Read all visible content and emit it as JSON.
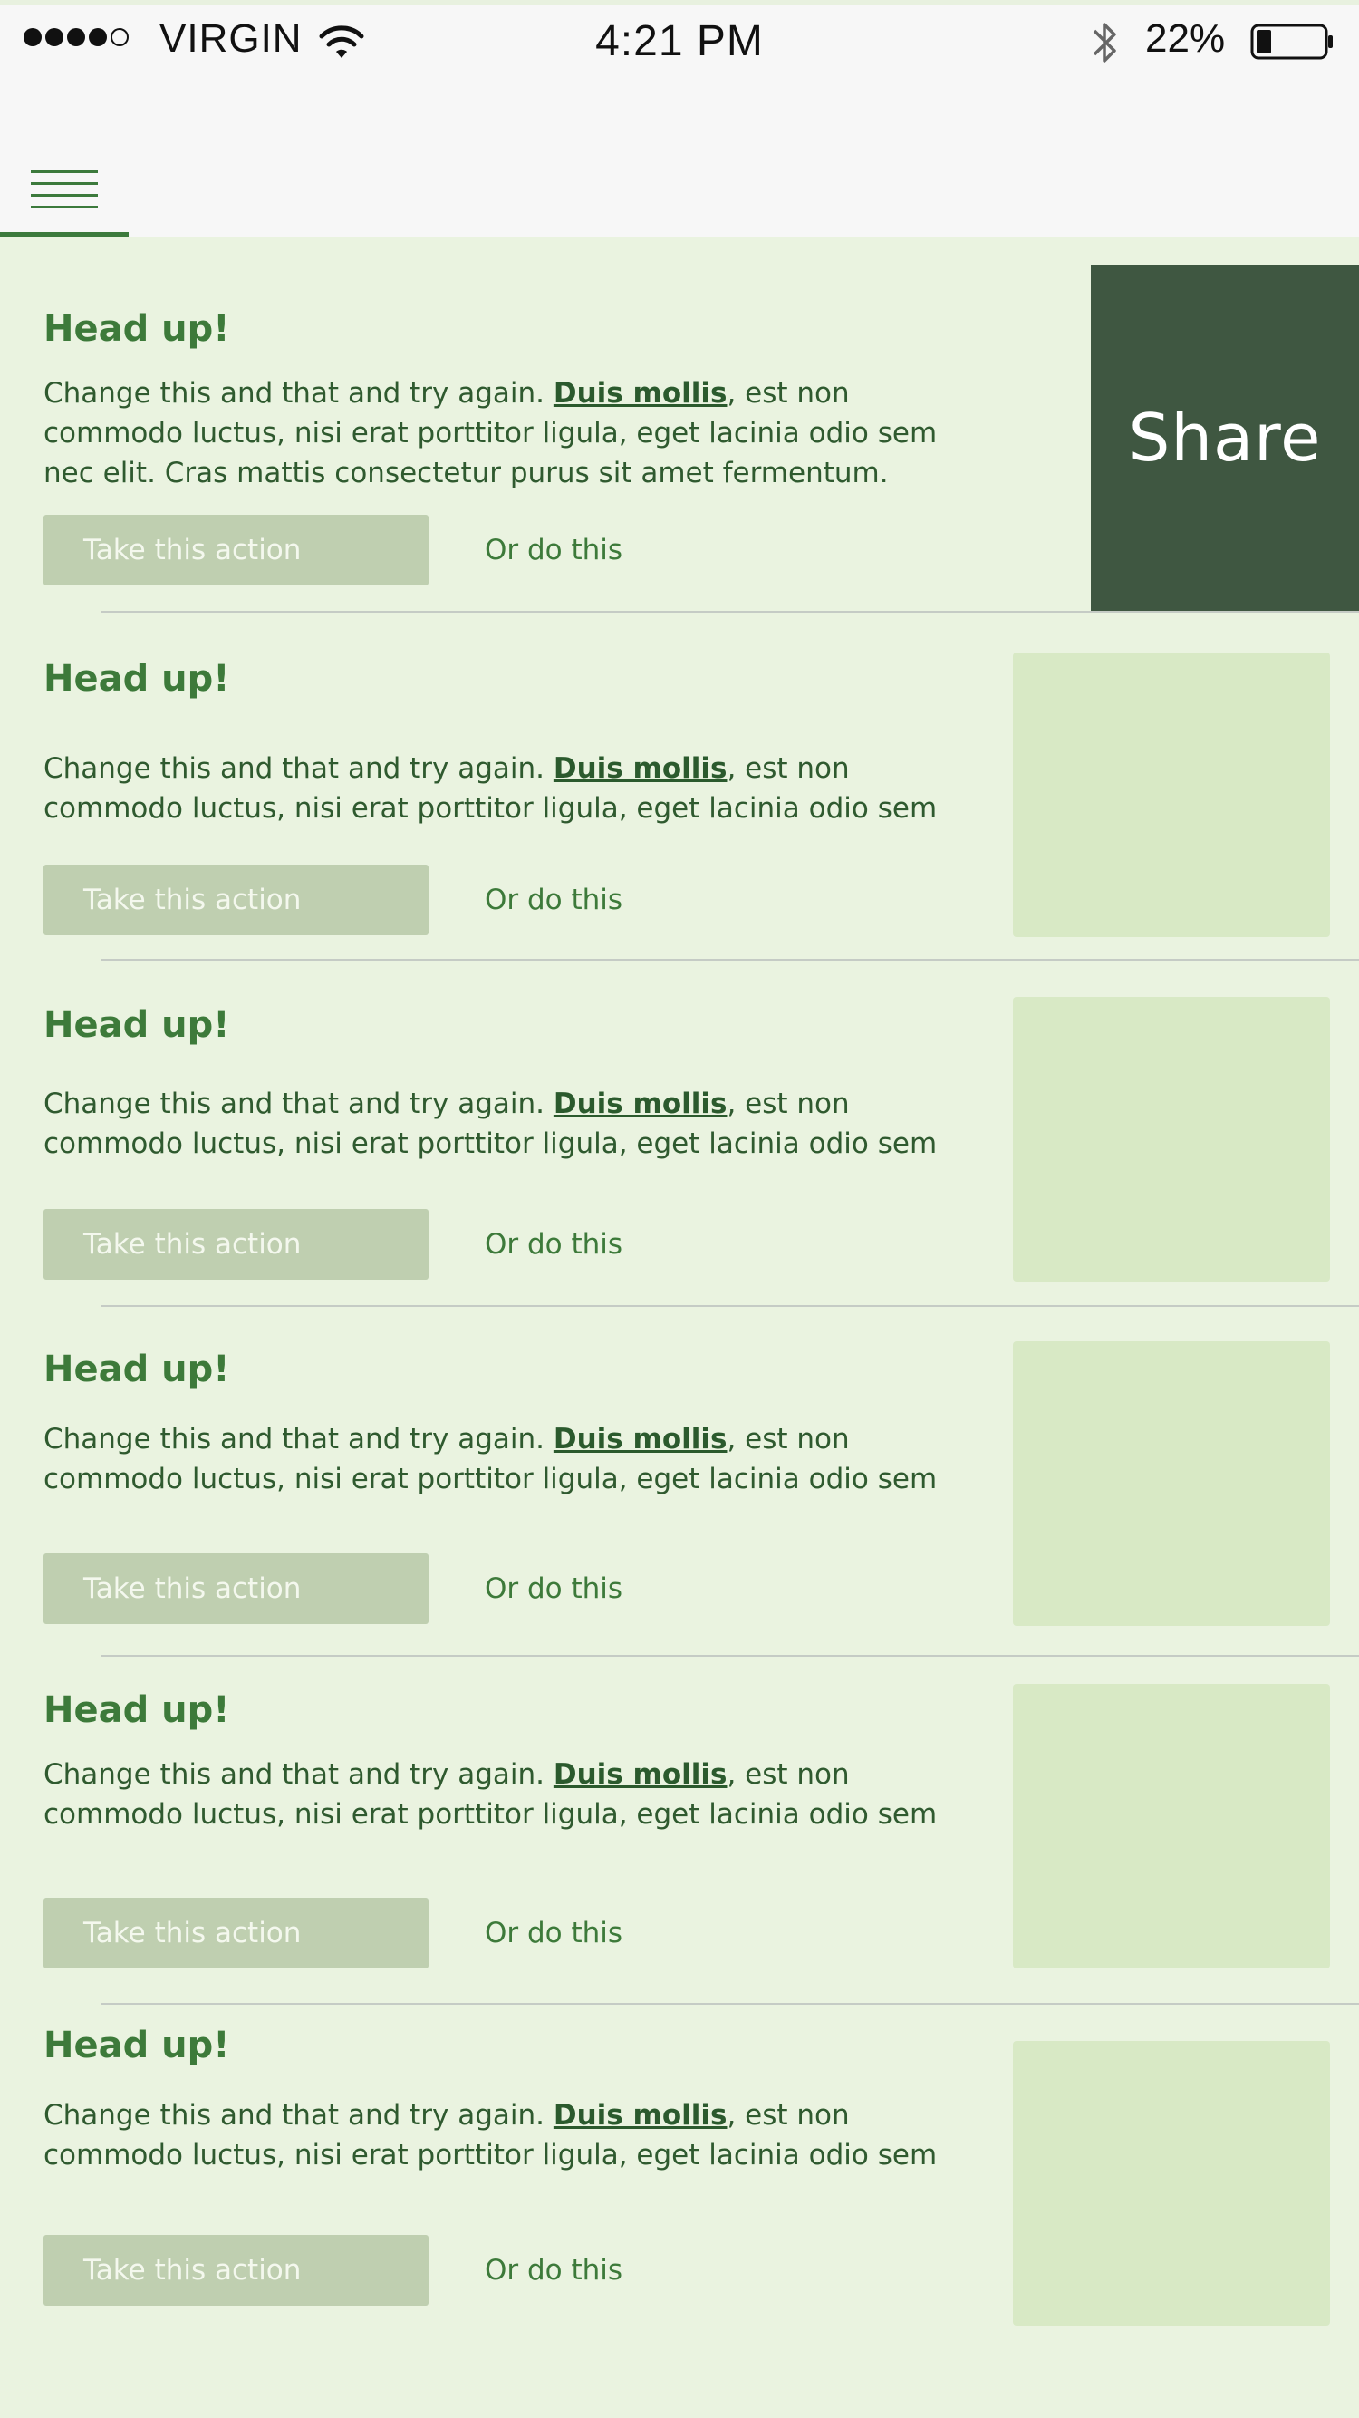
{
  "status_bar": {
    "carrier": "VIRGIN",
    "time": "4:21 PM",
    "battery_percent": "22%",
    "battery_level": 0.22,
    "signal_bars_filled": 4,
    "signal_bars_total": 5,
    "icons": [
      "signal-dots-icon",
      "wifi-icon",
      "bluetooth-icon",
      "battery-icon"
    ]
  },
  "nav": {
    "menu_icon": "hamburger-menu-icon"
  },
  "share": {
    "label": "Share"
  },
  "colors": {
    "background": "#eaf3e0",
    "accent": "#3d7a3a",
    "share_panel": "#3f5741",
    "button": "#bfcfb0",
    "thumbnail": "#d8e9c5"
  },
  "cards": [
    {
      "title": "Head up!",
      "text_before_link": "Change this and that and try again. ",
      "link": "Duis mollis",
      "text_after_link": ", est non commodo luctus, nisi erat porttitor ligula, eget lacinia odio sem nec elit. Cras mattis consectetur purus sit amet fermentum.",
      "primary_action": "Take this action",
      "secondary_action": "Or do this"
    },
    {
      "title": "Head up!",
      "text_before_link": "Change this and that and try again. ",
      "link": "Duis mollis",
      "text_after_link": ", est non commodo luctus, nisi erat porttitor ligula, eget lacinia odio sem nec elit. Cras",
      "primary_action": "Take this action",
      "secondary_action": "Or do this"
    },
    {
      "title": "Head up!",
      "text_before_link": "Change this and that and try again. ",
      "link": "Duis mollis",
      "text_after_link": ", est non commodo luctus, nisi erat porttitor ligula, eget lacinia odio sem nec elit. Cras",
      "primary_action": "Take this action",
      "secondary_action": "Or do this"
    },
    {
      "title": "Head up!",
      "text_before_link": "Change this and that and try again. ",
      "link": "Duis mollis",
      "text_after_link": ", est non commodo luctus, nisi erat porttitor ligula, eget lacinia odio sem nec elit. Cras",
      "primary_action": "Take this action",
      "secondary_action": "Or do this"
    },
    {
      "title": "Head up!",
      "text_before_link": "Change this and that and try again. ",
      "link": "Duis mollis",
      "text_after_link": ", est non commodo luctus, nisi erat porttitor ligula, eget lacinia odio sem nec elit. Cras",
      "primary_action": "Take this action",
      "secondary_action": "Or do this"
    },
    {
      "title": "Head up!",
      "text_before_link": "Change this and that and try again. ",
      "link": "Duis mollis",
      "text_after_link": ", est non commodo luctus, nisi erat porttitor ligula, eget lacinia odio sem nec elit. Cras",
      "primary_action": "Take this action",
      "secondary_action": "Or do this"
    }
  ]
}
